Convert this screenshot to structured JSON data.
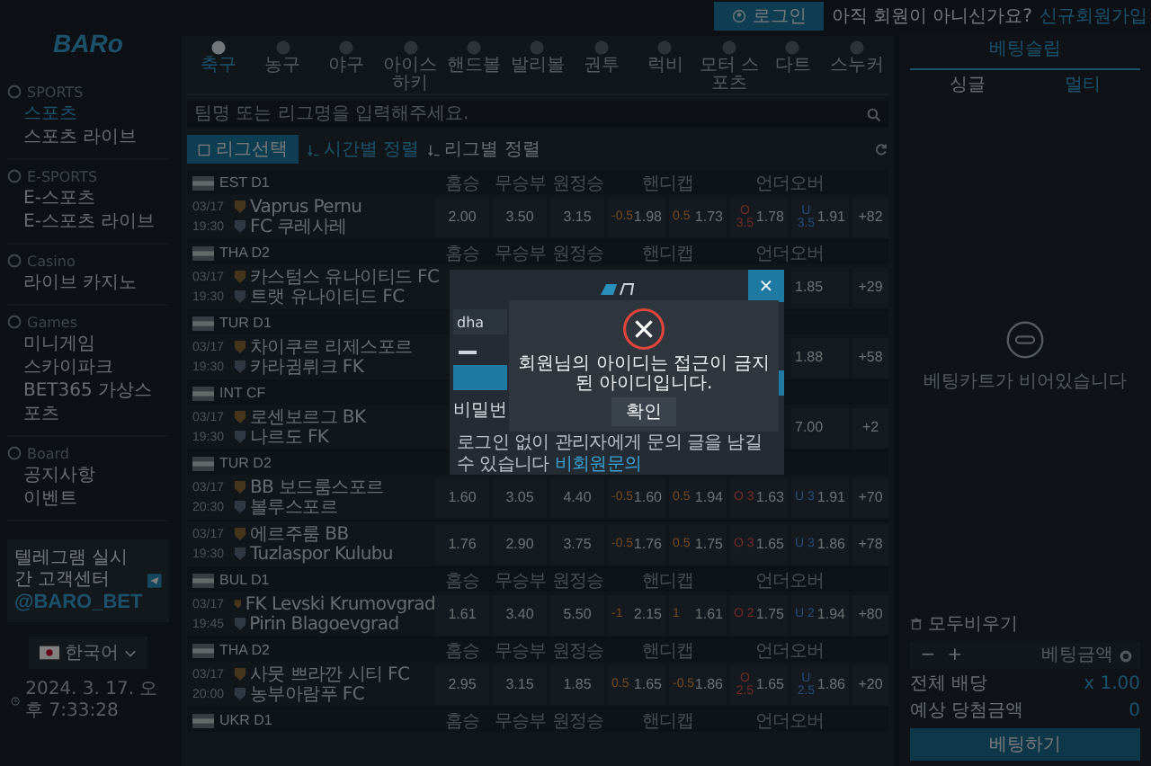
{
  "sidebar": {
    "logo": "BARo",
    "sections": [
      {
        "title": "SPORTS",
        "items": [
          {
            "label": "스포츠",
            "selected": true
          },
          {
            "label": "스포츠 라이브",
            "selected": false
          }
        ]
      },
      {
        "title": "E-SPORTS",
        "items": [
          {
            "label": "E-스포츠",
            "selected": false
          },
          {
            "label": "E-스포츠 라이브",
            "selected": false
          }
        ]
      },
      {
        "title": "Casino",
        "items": [
          {
            "label": "라이브 카지노",
            "selected": false
          }
        ]
      },
      {
        "title": "Games",
        "items": [
          {
            "label": "미니게임",
            "selected": false
          },
          {
            "label": "스카이파크",
            "selected": false
          },
          {
            "label": "BET365 가상스포츠",
            "selected": false
          }
        ]
      },
      {
        "title": "Board",
        "items": [
          {
            "label": "공지사항",
            "selected": false
          },
          {
            "label": "이벤트",
            "selected": false
          }
        ]
      }
    ],
    "banner": {
      "text": "텔레그램 실시간 고객센터",
      "handle": "@BARO_BET"
    },
    "language": "한국어",
    "clock": "2024. 3. 17. 오후 7:33:28"
  },
  "top_bar": {
    "login": "로그인",
    "prompt": "아직 회원이 아니신가요?",
    "signup": "신규회원가입"
  },
  "sports_tabs": [
    {
      "label": "축구",
      "selected": true
    },
    {
      "label": "농구",
      "selected": false
    },
    {
      "label": "야구",
      "selected": false
    },
    {
      "label": "아이스 하키",
      "selected": false
    },
    {
      "label": "핸드볼",
      "selected": false
    },
    {
      "label": "발리볼",
      "selected": false
    },
    {
      "label": "권투",
      "selected": false
    },
    {
      "label": "럭비",
      "selected": false
    },
    {
      "label": "모터 스포츠",
      "selected": false
    },
    {
      "label": "다트",
      "selected": false
    },
    {
      "label": "스누커",
      "selected": false
    }
  ],
  "search": {
    "placeholder": "팀명 또는 리그명을 입력해주세요."
  },
  "league_button": "리그선택",
  "sort_options": [
    {
      "label": "시간별 정렬",
      "selected": true
    },
    {
      "label": "리그별 정렬",
      "selected": false
    }
  ],
  "leagues": [
    {
      "name": "EST D1",
      "columns": [
        "홈승",
        "무승부",
        "원정승",
        "핸디캡",
        "언더오버"
      ],
      "matches": [
        {
          "date": "03/17",
          "time": "19:30",
          "home": "Vaprus Pernu",
          "away": "FC 쿠레사레",
          "more": "+82",
          "odds": [
            {
              "kind": "win",
              "value": "2.00"
            },
            {
              "kind": "win",
              "value": "3.50"
            },
            {
              "kind": "win",
              "value": "3.15"
            },
            {
              "kind": "handicap",
              "line": "-0.5",
              "value": "1.98"
            },
            {
              "kind": "handicap",
              "line": "0.5",
              "value": "1.73"
            },
            {
              "kind": "over",
              "line": "O 3.5",
              "value": "1.78"
            },
            {
              "kind": "under",
              "line": "U 3.5",
              "value": "1.91"
            }
          ]
        }
      ]
    },
    {
      "name": "THA D2",
      "columns": [
        "홈승",
        "무승부",
        "원정승",
        "핸디캡",
        "언더오버"
      ],
      "matches": [
        {
          "date": "03/17",
          "time": "19:30",
          "home": "카스텀스 유나이티드 FC",
          "away": "트랫 유나이티드 FC",
          "more": "+29",
          "odds": [
            {
              "kind": "under",
              "value": "1.85"
            }
          ]
        }
      ]
    },
    {
      "name": "TUR D1",
      "matches": [
        {
          "date": "03/17",
          "time": "19:30",
          "home": "차이쿠르 리제스포르",
          "away": "카라귐뤼크 FK",
          "more": "+58",
          "odds": [
            {
              "kind": "under",
              "value": "1.88"
            }
          ]
        }
      ]
    },
    {
      "name": "INT CF",
      "matches": [
        {
          "date": "03/17",
          "time": "19:30",
          "home": "로센보르그 BK",
          "away": "나르도 FK",
          "more": "+2",
          "odds": [
            {
              "kind": "under",
              "value": "7.00"
            }
          ]
        }
      ]
    },
    {
      "name": "TUR D2",
      "matches": [
        {
          "date": "03/17",
          "time": "20:30",
          "home": "BB 보드룸스포르",
          "away": "볼루스포르",
          "more": "+70",
          "odds": [
            {
              "kind": "win",
              "value": "1.60"
            },
            {
              "kind": "win",
              "value": "3.05"
            },
            {
              "kind": "win",
              "value": "4.40"
            },
            {
              "kind": "handicap",
              "line": "-0.5",
              "value": "1.60"
            },
            {
              "kind": "handicap",
              "line": "0.5",
              "value": "1.94"
            },
            {
              "kind": "over",
              "line": "O 3",
              "value": "1.63"
            },
            {
              "kind": "under",
              "line": "U 3",
              "value": "1.91"
            }
          ]
        },
        {
          "date": "03/17",
          "time": "19:30",
          "home": "에르주룸 BB",
          "away": "Tuzlaspor Kulubu",
          "more": "+78",
          "odds": [
            {
              "kind": "win",
              "value": "1.76"
            },
            {
              "kind": "win",
              "value": "2.90"
            },
            {
              "kind": "win",
              "value": "3.75"
            },
            {
              "kind": "handicap",
              "line": "-0.5",
              "value": "1.76"
            },
            {
              "kind": "handicap",
              "line": "0.5",
              "value": "1.75"
            },
            {
              "kind": "over",
              "line": "O 3",
              "value": "1.65"
            },
            {
              "kind": "under",
              "line": "U 3",
              "value": "1.86"
            }
          ]
        }
      ]
    },
    {
      "name": "BUL D1",
      "columns": [
        "홈승",
        "무승부",
        "원정승",
        "핸디캡",
        "언더오버"
      ],
      "matches": [
        {
          "date": "03/17",
          "time": "19:45",
          "home": "FK Levski Krumovgrad",
          "away": "Pirin Blagoevgrad",
          "more": "+80",
          "odds": [
            {
              "kind": "win",
              "value": "1.61"
            },
            {
              "kind": "win",
              "value": "3.40"
            },
            {
              "kind": "win",
              "value": "5.50"
            },
            {
              "kind": "handicap",
              "line": "-1",
              "value": "2.15"
            },
            {
              "kind": "handicap",
              "line": "1",
              "value": "1.61"
            },
            {
              "kind": "over",
              "line": "O 2",
              "value": "1.75"
            },
            {
              "kind": "under",
              "line": "U 2",
              "value": "1.94"
            }
          ]
        }
      ]
    },
    {
      "name": "THA D2",
      "columns": [
        "홈승",
        "무승부",
        "원정승",
        "핸디캡",
        "언더오버"
      ],
      "matches": [
        {
          "date": "03/17",
          "time": "20:00",
          "home": "사뭇 쁘라깐 시티 FC",
          "away": "농부아람푸 FC",
          "more": "+20",
          "odds": [
            {
              "kind": "win",
              "value": "2.95"
            },
            {
              "kind": "win",
              "value": "3.15"
            },
            {
              "kind": "win",
              "value": "1.85"
            },
            {
              "kind": "handicap",
              "line": "0.5",
              "value": "1.65"
            },
            {
              "kind": "handicap",
              "line": "-0.5",
              "value": "1.86"
            },
            {
              "kind": "over",
              "line": "O 2.5",
              "value": "1.65"
            },
            {
              "kind": "under",
              "line": "U 2.5",
              "value": "1.86"
            }
          ]
        }
      ]
    },
    {
      "name": "UKR D1",
      "columns": [
        "홈승",
        "무승부",
        "원정승",
        "핸디캡",
        "언더오버"
      ]
    }
  ],
  "bet_slip": {
    "title": "베팅슬립",
    "tabs": [
      {
        "label": "싱글",
        "selected": false
      },
      {
        "label": "멀티",
        "selected": true
      }
    ],
    "empty": "베팅카트가 비어있습니다",
    "clear": "모두비우기",
    "minus": "−",
    "plus": "+",
    "stake_placeholder": "베팅금액",
    "total_odds_label": "전체 배당",
    "total_odds": "x 1.00",
    "payout_label": "예상 당첨금액",
    "payout": "0",
    "submit": "베팅하기"
  },
  "login_modal": {
    "close": "×",
    "username": "dha",
    "password_label": "비밀번",
    "note": "로그인 없이 관리자에게 문의 글을 남길 수 있습니다",
    "note_link": "비회원문의"
  },
  "alert": {
    "message": "회원님의 아이디는 접근이 금지된 아이디입니다.",
    "button": "확인"
  }
}
